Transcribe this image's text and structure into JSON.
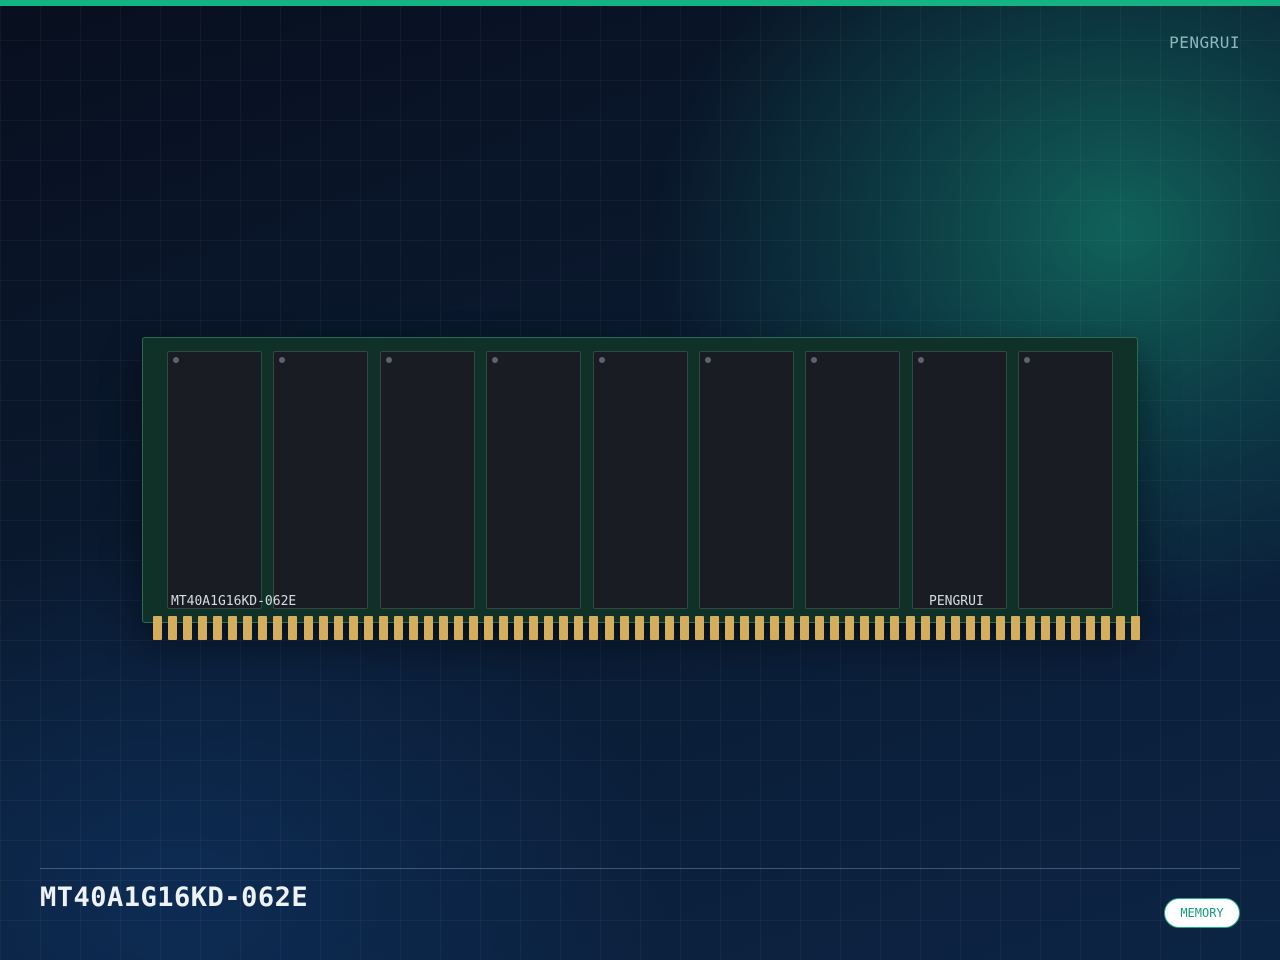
{
  "header": {
    "brand": "PENGRUI"
  },
  "module": {
    "chip_count": 9,
    "pin_count": 66,
    "silkscreen_part": "MT40A1G16KD-062E",
    "silkscreen_brand": "PENGRUI"
  },
  "footer": {
    "part_number": "MT40A1G16KD-062E",
    "category_badge": "MEMORY"
  },
  "colors": {
    "accent": "#13b382",
    "pcb": "#0f3127",
    "chip": "#1a1c23",
    "gold_contacts": "#d4ae5c"
  }
}
